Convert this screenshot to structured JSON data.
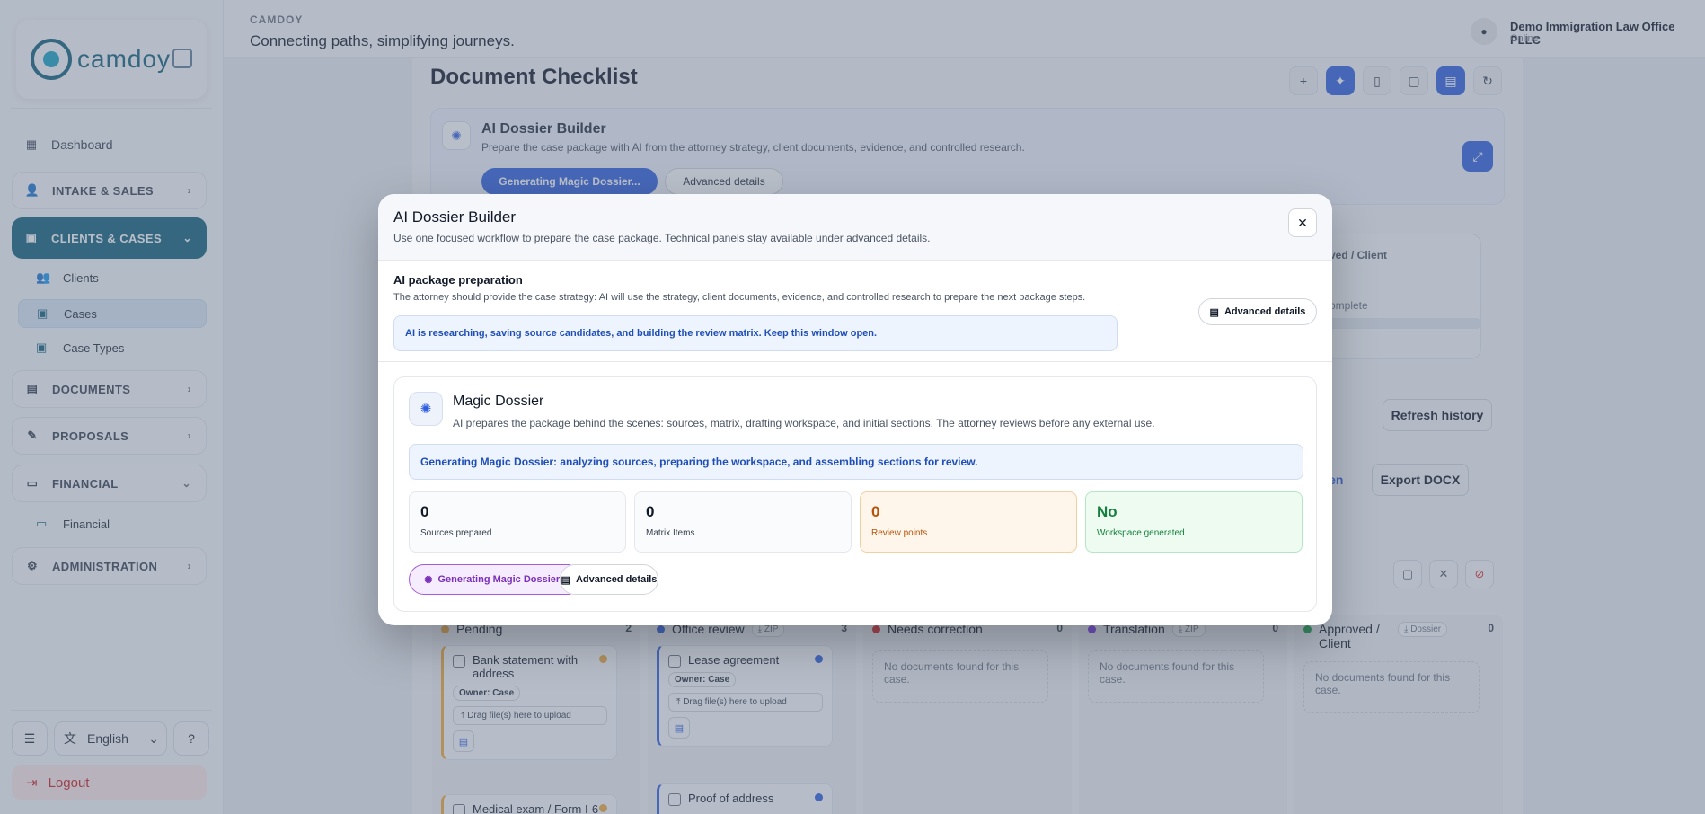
{
  "app": {
    "brand_small": "CAMDOY",
    "tagline": "Connecting paths, simplifying journeys.",
    "logo_text": "camdoy"
  },
  "user": {
    "name": "Demo Immigration Law Office PLLC",
    "status": "Online"
  },
  "sidebar": {
    "dashboard": "Dashboard",
    "intake": "INTAKE & SALES",
    "clients_cases": "CLIENTS & CASES",
    "clients": "Clients",
    "cases": "Cases",
    "case_types": "Case Types",
    "documents": "DOCUMENTS",
    "proposals": "PROPOSALS",
    "financial_group": "FINANCIAL",
    "financial": "Financial",
    "administration": "ADMINISTRATION",
    "language": "English",
    "logout": "Logout"
  },
  "page": {
    "title": "Document Checklist",
    "dossier_card": {
      "title": "AI Dossier Builder",
      "subtitle": "Prepare the case package with AI from the attorney strategy, client documents, evidence, and controlled research.",
      "primary": "Generating Magic Dossier...",
      "secondary": "Advanced details"
    },
    "bg_status_label": "ved / Client",
    "bg_complete": "omplete",
    "refresh_history": "Refresh history",
    "open_label": "pen",
    "export_docx": "Export DOCX"
  },
  "kanban": {
    "pending": {
      "title": "Pending",
      "count": "2"
    },
    "office_review": {
      "title": "Office review",
      "chip": "ZIP",
      "count": "3"
    },
    "needs_correction": {
      "title": "Needs correction",
      "count": "0"
    },
    "translation": {
      "title": "Translation",
      "chip": "ZIP",
      "count": "0"
    },
    "approved": {
      "title": "Approved / Client",
      "chip": "Dossier",
      "count": "0"
    },
    "empty_text": "No documents found for this case.",
    "cards": {
      "bank": "Bank statement with address",
      "medical": "Medical exam / Form I-6",
      "lease": "Lease agreement",
      "proof": "Proof of address",
      "owner": "Owner: Case",
      "drop": "Drag file(s) here to upload"
    }
  },
  "modal": {
    "title": "AI Dossier Builder",
    "subtitle": "Use one focused workflow to prepare the case package. Technical panels stay available under advanced details.",
    "prep_title": "AI package preparation",
    "prep_subtitle": "The attorney should provide the case strategy: AI will use the strategy, client documents, evidence, and controlled research to prepare the next package steps.",
    "prep_info": "AI is researching, saving source candidates, and building the review matrix. Keep this window open.",
    "advanced_details": "Advanced details",
    "magic": {
      "title": "Magic Dossier",
      "subtitle": "AI prepares the package behind the scenes: sources, matrix, drafting workspace, and initial sections. The attorney reviews before any external use.",
      "info": "Generating Magic Dossier: analyzing sources, preparing the workspace, and assembling sections for review.",
      "stats": [
        {
          "value": "0",
          "label": "Sources prepared"
        },
        {
          "value": "0",
          "label": "Matrix Items"
        },
        {
          "value": "0",
          "label": "Review points"
        },
        {
          "value": "No",
          "label": "Workspace generated"
        }
      ],
      "generate_btn": "Generating Magic Dossier...",
      "advanced_btn": "Advanced details"
    }
  },
  "colors": {
    "accent": "#2f5fe0",
    "sidebar_active": "#0f5f7a",
    "pending": "#f0a93b",
    "review": "#2f5fe0",
    "correction": "#dc2626",
    "translation": "#7c3aed",
    "approved": "#16a34a"
  }
}
